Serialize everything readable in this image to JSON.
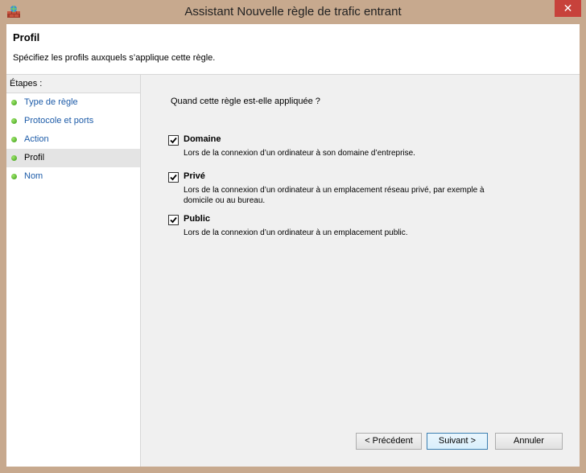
{
  "window": {
    "title": "Assistant Nouvelle règle de trafic entrant",
    "close_label": "✕"
  },
  "header": {
    "title": "Profil",
    "subtitle": "Spécifiez les profils auxquels s’applique cette règle."
  },
  "steps": {
    "heading": "Étapes :",
    "items": [
      {
        "label": "Type de règle",
        "current": false
      },
      {
        "label": "Protocole et ports",
        "current": false
      },
      {
        "label": "Action",
        "current": false
      },
      {
        "label": "Profil",
        "current": true
      },
      {
        "label": "Nom",
        "current": false
      }
    ]
  },
  "content": {
    "question": "Quand cette règle est-elle appliquée ?",
    "options": [
      {
        "label": "Domaine",
        "checked": true,
        "description": "Lors de la connexion d’un ordinateur à son domaine d’entreprise."
      },
      {
        "label": "Privé",
        "checked": true,
        "description": "Lors de la connexion d’un ordinateur à un emplacement réseau privé, par exemple à domicile ou au bureau."
      },
      {
        "label": "Public",
        "checked": true,
        "description": "Lors de la connexion d’un ordinateur à un emplacement public."
      }
    ]
  },
  "buttons": {
    "back": "< Précédent",
    "next": "Suivant >",
    "cancel": "Annuler"
  },
  "colors": {
    "titlebar": "#c7a98e",
    "close_button": "#c7423b",
    "link": "#1c5ba8",
    "step_dot": "#3a9b16"
  }
}
